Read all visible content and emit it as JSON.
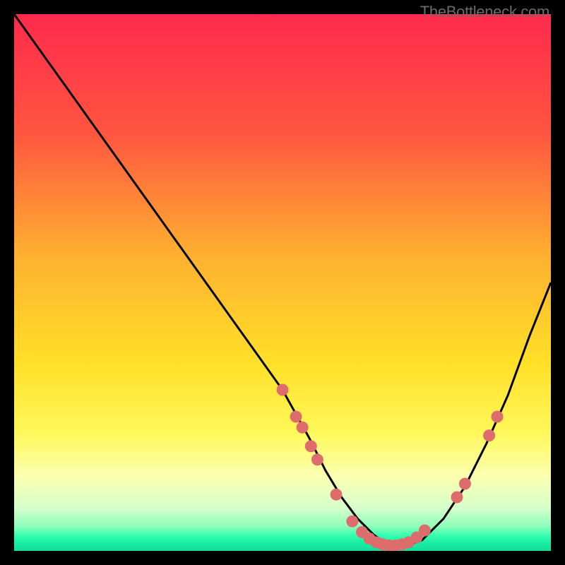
{
  "watermark": "TheBottleneck.com",
  "chart_data": {
    "type": "line",
    "title": "",
    "xlabel": "",
    "ylabel": "",
    "xlim": [
      0,
      100
    ],
    "ylim": [
      0,
      100
    ],
    "grid": false,
    "legend": false,
    "gradient_stops": [
      {
        "offset": 0.0,
        "color": "#ff2a4d"
      },
      {
        "offset": 0.22,
        "color": "#ff5540"
      },
      {
        "offset": 0.45,
        "color": "#ffb030"
      },
      {
        "offset": 0.65,
        "color": "#ffe028"
      },
      {
        "offset": 0.78,
        "color": "#fff85a"
      },
      {
        "offset": 0.86,
        "color": "#fcffb0"
      },
      {
        "offset": 0.92,
        "color": "#d6ffcb"
      },
      {
        "offset": 0.955,
        "color": "#8cffbb"
      },
      {
        "offset": 0.97,
        "color": "#3cffb0"
      },
      {
        "offset": 0.985,
        "color": "#18eea5"
      },
      {
        "offset": 1.0,
        "color": "#13dd9a"
      }
    ],
    "series": [
      {
        "name": "curve",
        "x": [
          0,
          5,
          10,
          15,
          20,
          25,
          30,
          35,
          40,
          45,
          50,
          55,
          58,
          61,
          64,
          67,
          70,
          73,
          76,
          80,
          84,
          88,
          92,
          96,
          100
        ],
        "y": [
          100,
          93,
          86,
          79,
          72,
          65,
          58,
          51,
          44,
          37,
          30,
          21,
          15,
          10,
          6,
          3,
          1,
          1,
          2,
          6,
          12,
          20,
          29,
          40,
          50
        ]
      }
    ],
    "markers": [
      {
        "x": 50.0,
        "y": 30.0
      },
      {
        "x": 52.5,
        "y": 25.0
      },
      {
        "x": 53.7,
        "y": 23.0
      },
      {
        "x": 55.3,
        "y": 19.5
      },
      {
        "x": 56.5,
        "y": 17.0
      },
      {
        "x": 60.0,
        "y": 10.5
      },
      {
        "x": 63.0,
        "y": 5.5
      },
      {
        "x": 64.8,
        "y": 3.5
      },
      {
        "x": 66.2,
        "y": 2.3
      },
      {
        "x": 67.5,
        "y": 1.6
      },
      {
        "x": 68.7,
        "y": 1.2
      },
      {
        "x": 69.8,
        "y": 1.0
      },
      {
        "x": 71.0,
        "y": 1.0
      },
      {
        "x": 72.2,
        "y": 1.2
      },
      {
        "x": 73.5,
        "y": 1.6
      },
      {
        "x": 75.0,
        "y": 2.5
      },
      {
        "x": 76.5,
        "y": 3.8
      },
      {
        "x": 82.5,
        "y": 10.0
      },
      {
        "x": 84.0,
        "y": 12.5
      },
      {
        "x": 88.5,
        "y": 21.5
      },
      {
        "x": 90.0,
        "y": 25.0
      }
    ]
  }
}
